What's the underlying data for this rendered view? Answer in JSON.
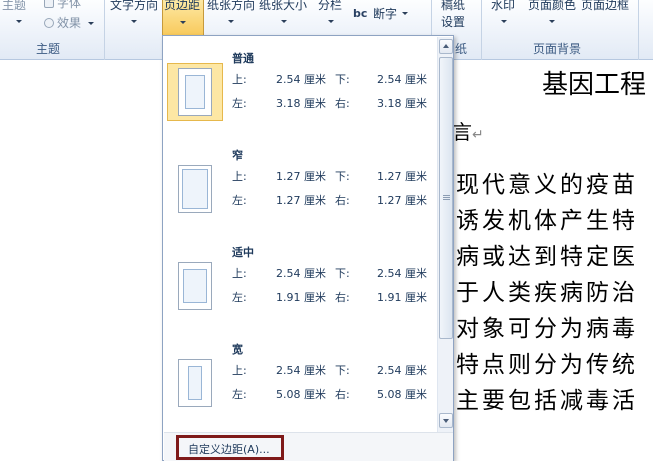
{
  "ribbon": {
    "theme_group": {
      "label": "主题",
      "item_top": "主题",
      "item_font": "字体",
      "item_effect": "效果"
    },
    "page_setup": {
      "text_direction": "文字方向",
      "margins": "页边距",
      "orientation": "纸张方向",
      "size": "纸张大小",
      "columns": "分栏",
      "hyphenation": "断字",
      "hyphen_icon": "bc"
    },
    "draft": {
      "line1": "稿纸",
      "line2": "设置",
      "group_label": "纸"
    },
    "page_background": {
      "watermark": "水印",
      "page_color": "页面颜色",
      "page_border": "页面边框",
      "group_label": "页面背景"
    }
  },
  "margins_menu": {
    "presets": [
      {
        "name": "普通",
        "top_label": "上:",
        "top": "2.54 厘米",
        "bottom_label": "下:",
        "bottom": "2.54 厘米",
        "left_label": "左:",
        "left": "3.18 厘米",
        "right_label": "右:",
        "right": "3.18 厘米",
        "selected": true
      },
      {
        "name": "窄",
        "top_label": "上:",
        "top": "1.27 厘米",
        "bottom_label": "下:",
        "bottom": "1.27 厘米",
        "left_label": "左:",
        "left": "1.27 厘米",
        "right_label": "右:",
        "right": "1.27 厘米",
        "selected": false
      },
      {
        "name": "适中",
        "top_label": "上:",
        "top": "2.54 厘米",
        "bottom_label": "下:",
        "bottom": "2.54 厘米",
        "left_label": "左:",
        "left": "1.91 厘米",
        "right_label": "右:",
        "right": "1.91 厘米",
        "selected": false
      },
      {
        "name": "宽",
        "top_label": "上:",
        "top": "2.54 厘米",
        "bottom_label": "下:",
        "bottom": "2.54 厘米",
        "left_label": "左:",
        "left": "5.08 厘米",
        "right_label": "右:",
        "right": "5.08 厘米",
        "selected": false
      }
    ],
    "custom_button": "自定义边距(A)..."
  },
  "document": {
    "title": "基因工程",
    "heading_fragment": "言",
    "lines": [
      "现代意义的疫苗",
      "诱发机体产生特",
      "病或达到特定医",
      "于人类疾病防治",
      "对象可分为病毒",
      "特点则分为传统",
      "主要包括减毒活"
    ]
  },
  "colors": {
    "highlight": "#fde7a4",
    "callout_border": "#7f1a1a",
    "ribbon_text": "#1e395b"
  }
}
